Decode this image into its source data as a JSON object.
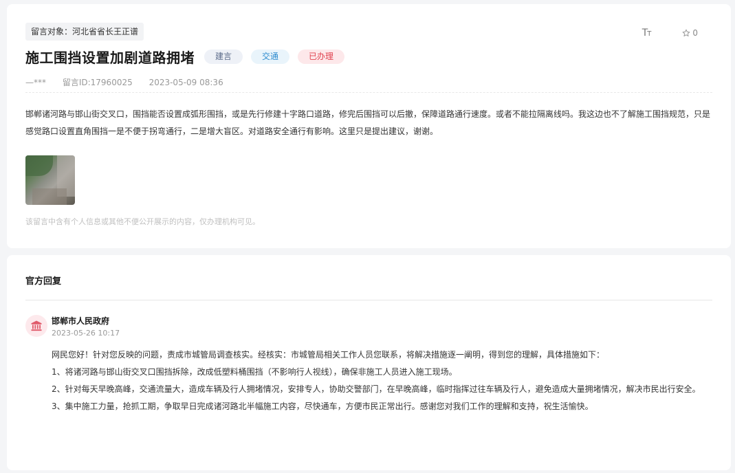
{
  "message": {
    "target_label": "留言对象：河北省省长王正谱",
    "title": "施工围挡设置加剧道路拥堵",
    "tags": [
      "建言",
      "交通",
      "已办理"
    ],
    "tools": {
      "font_size_icon": "font-size-icon",
      "star_icon": "star-icon",
      "star_count": "0"
    },
    "author": "—***",
    "message_id": "留言ID:17960025",
    "datetime": "2023-05-09 08:36",
    "content": "邯郸诸河路与邯山街交叉口，围挡能否设置成弧形围挡，或是先行修建十字路口道路，修完后围挡可以后撤，保障道路通行速度。或者不能拉隔离线吗。我这边也不了解施工围挡规范，只是感觉路口设置直角围挡一是不便于拐弯通行，二是增大盲区。对道路安全通行有影响。这里只是提出建议，谢谢。",
    "privacy_note": "该留言中含有个人信息或其他不便公开展示的内容，仅办理机构可见。"
  },
  "reply": {
    "heading": "官方回复",
    "org_icon": "government-building-icon",
    "org_name": "邯郸市人民政府",
    "datetime": "2023-05-26 10:17",
    "paragraphs": [
      "网民您好！针对您反映的问题，责成市城管局调查核实。经核实：市城管局相关工作人员您联系，将解决措施逐一阐明，得到您的理解，具体措施如下：",
      "1、将诸河路与邯山街交叉口围挡拆除，改成低塑料桶围挡（不影响行人视线），确保非施工人员进入施工现场。",
      "2、针对每天早晚高峰，交通流量大，造成车辆及行人拥堵情况，安排专人，协助交警部门，在早晚高峰，临时指挥过往车辆及行人，避免造成大量拥堵情况，解决市民出行安全。",
      "3、集中施工力量，抢抓工期，争取早日完成诸河路北半幅施工内容，尽快通车，方便市民正常出行。感谢您对我们工作的理解和支持，祝生活愉快。"
    ]
  }
}
